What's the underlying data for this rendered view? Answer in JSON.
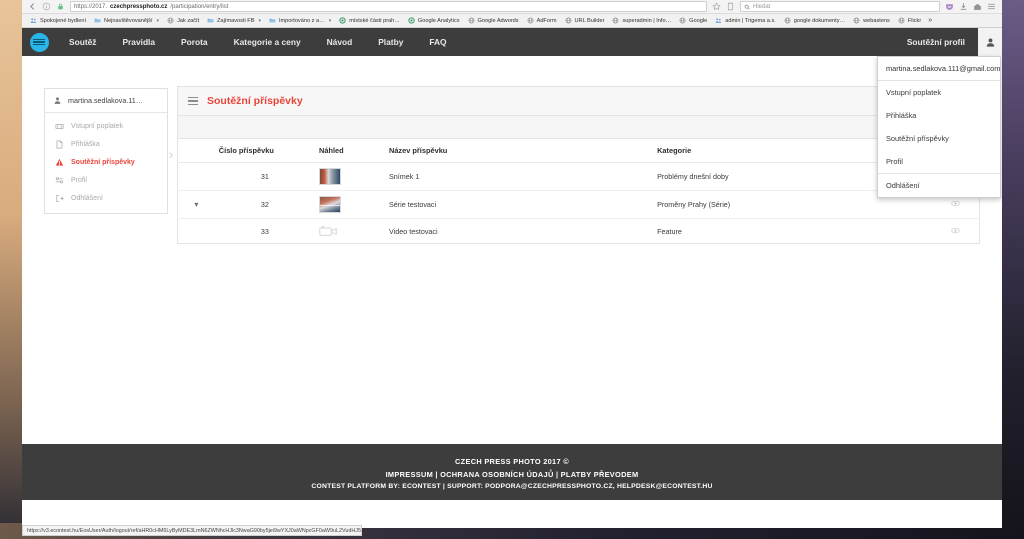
{
  "browser": {
    "url_prefix": "https://2017.",
    "url_host": "czechpressphoto.cz",
    "url_path": "/participation/entry/list",
    "search_placeholder": "Hledat",
    "bookmarks": [
      {
        "label": "Spokojené bydlení",
        "icon": "people-icon",
        "caret": false
      },
      {
        "label": "Nejnavštěvovanější",
        "icon": "folder-icon",
        "caret": true
      },
      {
        "label": "Jak začít",
        "icon": "globe-icon",
        "caret": false
      },
      {
        "label": "Zajímavosti FB",
        "icon": "folder-icon",
        "caret": true
      },
      {
        "label": "Importováno z a…",
        "icon": "folder-icon",
        "caret": true
      },
      {
        "label": "místské části prah…",
        "icon": "chrome-icon",
        "caret": false
      },
      {
        "label": "Google Analytics",
        "icon": "chrome-icon",
        "caret": false
      },
      {
        "label": "Google Adwords",
        "icon": "globe-icon",
        "caret": false
      },
      {
        "label": "AdForm",
        "icon": "globe-icon",
        "caret": false
      },
      {
        "label": "URL Builder",
        "icon": "globe-icon",
        "caret": false
      },
      {
        "label": "superadmin | Info…",
        "icon": "globe-icon",
        "caret": false
      },
      {
        "label": "Google",
        "icon": "globe-icon",
        "caret": false
      },
      {
        "label": "admin | Trigema a.s.",
        "icon": "people-icon",
        "caret": false
      },
      {
        "label": "google dokumenty…",
        "icon": "globe-icon",
        "caret": false
      },
      {
        "label": "webastens",
        "icon": "globe-icon",
        "caret": false
      },
      {
        "label": "Flickr",
        "icon": "globe-icon",
        "caret": false
      }
    ],
    "overflow_label": "»",
    "status_url": "https://v3.econtest.hu/EosUser/Auth/logout/ref/aHR0cHM6LyByMDE3LmN6ZWNhcHJlc3NwaG90by5jei9wYXJ0aWNpcGF0aW9uL2VudHJ5L2xpc3Q=?lang=cs&contest=37"
  },
  "navbar": {
    "brand": "czech-press-photo-logo",
    "items": [
      {
        "label": "Soutěž"
      },
      {
        "label": "Pravidla"
      },
      {
        "label": "Porota"
      },
      {
        "label": "Kategorie a ceny"
      },
      {
        "label": "Návod"
      },
      {
        "label": "Platby"
      },
      {
        "label": "FAQ"
      }
    ],
    "profile_label": "Soutěžní profil",
    "user_icon": "user-icon"
  },
  "dropdown": {
    "email": "martina.sedlakova.111@gmail.com",
    "items": [
      {
        "label": "Vstupní poplatek"
      },
      {
        "label": "Přihláška"
      },
      {
        "label": "Soutěžní příspěvky"
      },
      {
        "label": "Profil"
      },
      {
        "label": "Odhlášení"
      }
    ]
  },
  "sidebar": {
    "user": "martina.sedlakova.11…",
    "items": [
      {
        "label": "Vstupní poplatek",
        "icon": "ticket-icon",
        "active": false
      },
      {
        "label": "Přihláška",
        "icon": "document-icon",
        "active": false
      },
      {
        "label": "Soutěžní příspěvky",
        "icon": "alert-icon",
        "active": true
      },
      {
        "label": "Profil",
        "icon": "settings-icon",
        "active": false
      },
      {
        "label": "Odhlášení",
        "icon": "logout-icon",
        "active": false
      }
    ]
  },
  "panel": {
    "title": "Soutěžní příspěvky",
    "menu_icon": "hamburger-icon"
  },
  "table": {
    "columns": [
      "",
      "Číslo příspěvku",
      "Náhled",
      "Název příspěvku",
      "Kategorie",
      ""
    ],
    "rows": [
      {
        "expand": "",
        "number": "31",
        "thumb": "photo-thumbnail",
        "name": "Snímek 1",
        "category": "Problémy dnešní doby",
        "eye": false
      },
      {
        "expand": "▾",
        "number": "32",
        "thumb": "photo-series-thumbnail",
        "name": "Série testovaci",
        "category": "Proměny Prahy (Série)",
        "eye": true
      },
      {
        "expand": "",
        "number": "33",
        "thumb": "video-icon",
        "name": "Video testovaci",
        "category": "Feature",
        "eye": true
      }
    ]
  },
  "footer": {
    "line1": "CZECH PRESS PHOTO 2017 ©",
    "line2": "IMPRESSUM |  OCHRANA OSOBNÍCH ÚDAJŮ |  PLATBY PŘEVODEM",
    "line3": "CONTEST PLATFORM BY: ECONTEST | SUPPORT: PODPORA@CZECHPRESSPHOTO.CZ, HELPDESK@ECONTEST.HU"
  },
  "colors": {
    "accent_red": "#e8443a",
    "navbar_dark": "#3d3d3d",
    "brand_cyan": "#29b6e8"
  }
}
